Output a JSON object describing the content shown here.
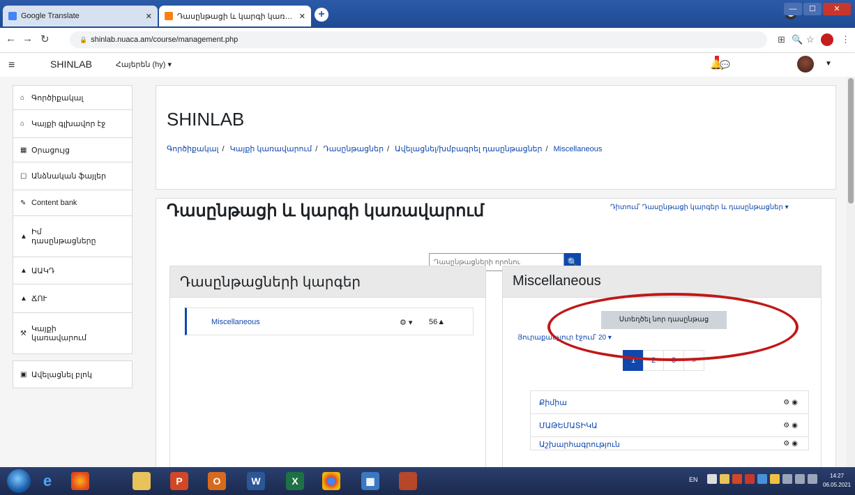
{
  "browser": {
    "tabs": [
      {
        "title": "Google Translate",
        "icon": "google-translate-icon"
      },
      {
        "title": "Դասընթացի և կարգի կառավա...",
        "icon": "moodle-icon"
      }
    ],
    "new_tab_symbol": "+",
    "url": "shinlab.nuaca.am/course/management.php"
  },
  "app": {
    "brand": "SHINLAB",
    "language": "Հայերեն (hy) ▾"
  },
  "sidebar": {
    "items": [
      {
        "label": "Գործիքակալ",
        "icon": "home-icon"
      },
      {
        "label": "Կայքի գլխավոր էջ",
        "icon": "site-home-icon"
      },
      {
        "label": "Օրացույց",
        "icon": "calendar-icon"
      },
      {
        "label": "Անձնական ֆայլեր",
        "icon": "file-icon"
      },
      {
        "label": "Content bank",
        "icon": "pencil-icon"
      },
      {
        "label": "Իմ դասընթացները",
        "icon": "graduation-cap-icon"
      },
      {
        "label": "ԱԱԿԴ",
        "icon": "graduation-cap-icon"
      },
      {
        "label": "ՃՈՒ",
        "icon": "graduation-cap-icon"
      },
      {
        "label": "Կայքի կառավարում",
        "icon": "wrench-icon"
      },
      {
        "label": "Ավելացնել բլոկ",
        "icon": "plus-square-icon"
      }
    ]
  },
  "header": {
    "title": "SHINLAB",
    "breadcrumb": [
      "Գործիքակալ",
      "Կայքի կառավարում",
      "Դասընթացներ",
      "Ավելացնել/խմբագրել դասընթացներ",
      "Miscellaneous"
    ]
  },
  "main": {
    "title": "Դասընթացի և կարգի կառավարում",
    "view_menu": "Դիտում՝ Դասընթացի կարգեր և դասընթացներ ▾",
    "search_placeholder": "Դասընթացների որոնու",
    "categories_panel": {
      "title": "Դասընթացների կարգեր",
      "rows": [
        {
          "name": "Miscellaneous",
          "count": "56"
        }
      ]
    },
    "courses_panel": {
      "title": "Miscellaneous",
      "new_course_button": "Ստեղծել նոր դասընթաց",
      "per_page": "Յուրաքանչյուր էջում՝ 20 ▾",
      "pages": [
        "1",
        "2",
        "3",
        "»"
      ],
      "courses": [
        "Քիմիա",
        "ՄԱԹԵՄԱՏԻԿԱ",
        "Աշխարհագրություն"
      ]
    }
  },
  "taskbar": {
    "apps": [
      "e",
      "ff",
      "📁",
      "P",
      "O",
      "W",
      "X",
      "G",
      "▦",
      "P"
    ],
    "lang": "EN",
    "clock_time": "14:27",
    "clock_date": "06.05.2021"
  }
}
